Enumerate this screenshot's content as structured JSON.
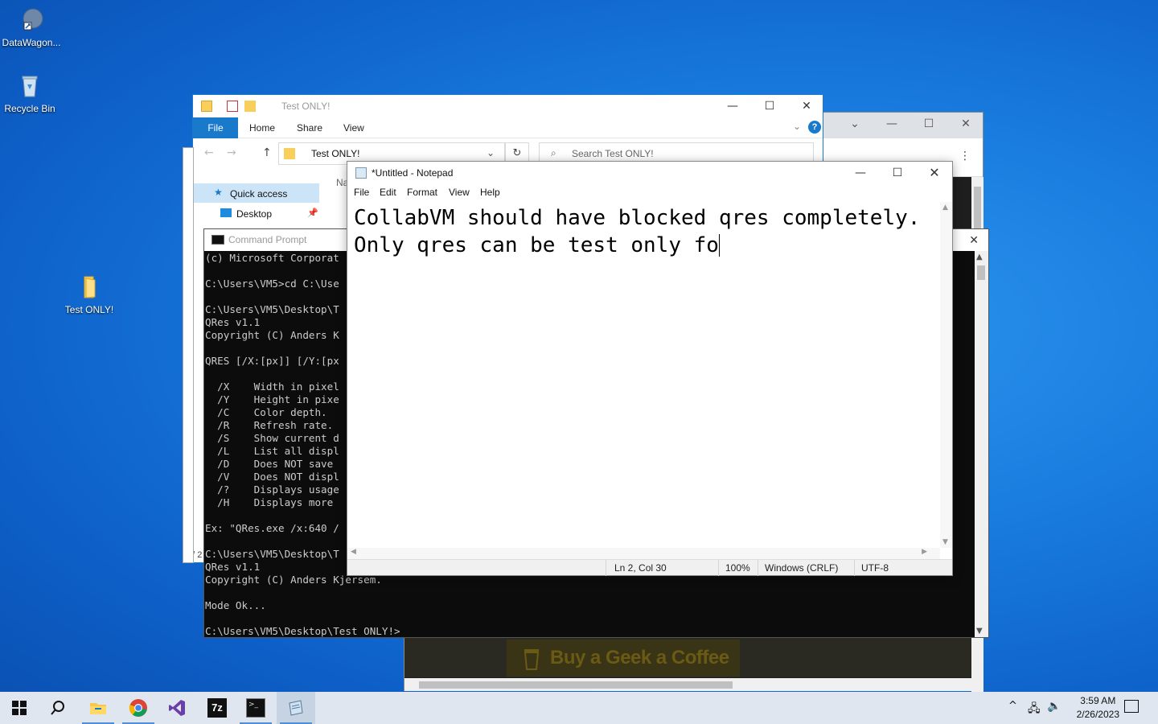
{
  "desktop": {
    "icons": [
      {
        "label": "DataWagon..."
      },
      {
        "label": "Recycle Bin"
      },
      {
        "label": "Test ONLY!"
      }
    ]
  },
  "browser": {
    "coffee_label": "Buy a Geek a Coffee"
  },
  "explorer": {
    "title": "Test ONLY!",
    "ribbon_tabs": [
      "File",
      "Home",
      "Share",
      "View"
    ],
    "address": "Test ONLY!",
    "search_placeholder": "Search Test ONLY!",
    "nav_items": [
      "Quick access",
      "Desktop"
    ],
    "column_partial": "Na",
    "status_partial": "0 / 2"
  },
  "cmd": {
    "title": "Command Prompt",
    "lines": [
      "(c) Microsoft Corporat",
      "",
      "C:\\Users\\VM5>cd C:\\Use",
      "",
      "C:\\Users\\VM5\\Desktop\\T",
      "QRes v1.1",
      "Copyright (C) Anders K",
      "",
      "QRES [/X:[px]] [/Y:[px",
      "",
      "  /X    Width in pixel",
      "  /Y    Height in pixe",
      "  /C    Color depth.",
      "  /R    Refresh rate.",
      "  /S    Show current d",
      "  /L    List all displ",
      "  /D    Does NOT save ",
      "  /V    Does NOT displ",
      "  /?    Displays usage",
      "  /H    Displays more ",
      "",
      "Ex: \"QRes.exe /x:640 /",
      "",
      "C:\\Users\\VM5\\Desktop\\T",
      "QRes v1.1",
      "Copyright (C) Anders Kjersem.",
      "",
      "Mode Ok...",
      "",
      "C:\\Users\\VM5\\Desktop\\Test ONLY!>"
    ]
  },
  "notepad": {
    "title": "*Untitled - Notepad",
    "menu": [
      "File",
      "Edit",
      "Format",
      "View",
      "Help"
    ],
    "line1": "CollabVM should have blocked qres completely.",
    "line2": "Only qres can be test only fo",
    "status": {
      "position": "Ln 2, Col 30",
      "zoom": "100%",
      "line_ending": "Windows (CRLF)",
      "encoding": "UTF-8"
    }
  },
  "taskbar": {
    "time": "3:59 AM",
    "date": "2/26/2023"
  },
  "colors": {
    "accent": "#1979ca",
    "taskbar": "#dfe6ef",
    "console_bg": "#0c0c0c"
  }
}
